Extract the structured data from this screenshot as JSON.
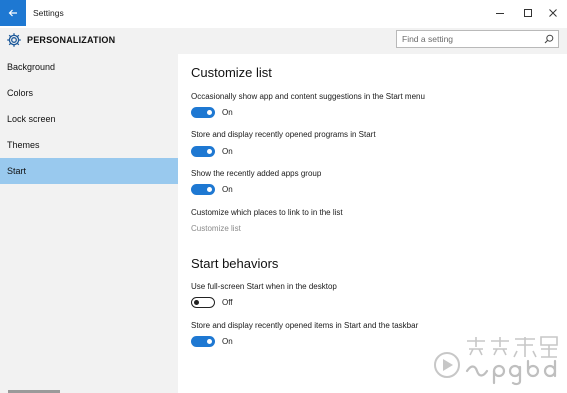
{
  "window": {
    "title": "Settings",
    "controls": {
      "minimize": "minimize-icon",
      "maximize": "maximize-icon",
      "close": "close-icon"
    }
  },
  "header": {
    "section_title": "PERSONALIZATION",
    "icon": "gear-icon",
    "search": {
      "placeholder": "Find a setting",
      "value": "",
      "icon": "search-icon"
    }
  },
  "sidebar": {
    "items": [
      {
        "label": "Background",
        "selected": false
      },
      {
        "label": "Colors",
        "selected": false
      },
      {
        "label": "Lock screen",
        "selected": false
      },
      {
        "label": "Themes",
        "selected": false
      },
      {
        "label": "Start",
        "selected": true
      }
    ]
  },
  "main": {
    "customize_list": {
      "heading": "Customize list",
      "settings": [
        {
          "label": "Occasionally show app and content suggestions in the Start menu",
          "state": "On"
        },
        {
          "label": "Store and display recently opened programs in Start",
          "state": "On"
        },
        {
          "label": "Show the recently added apps group",
          "state": "On"
        }
      ],
      "places_label": "Customize which places to link to in the list",
      "places_link": "Customize list"
    },
    "start_behaviors": {
      "heading": "Start behaviors",
      "settings": [
        {
          "label": "Use full-screen Start when in the desktop",
          "state": "Off"
        },
        {
          "label": "Store and display recently opened items in Start and the taskbar",
          "state": "On"
        }
      ]
    }
  },
  "colors": {
    "accent": "#1e78d2",
    "selected_nav": "#99c9ee",
    "pane_bg": "#f2f2f2"
  }
}
